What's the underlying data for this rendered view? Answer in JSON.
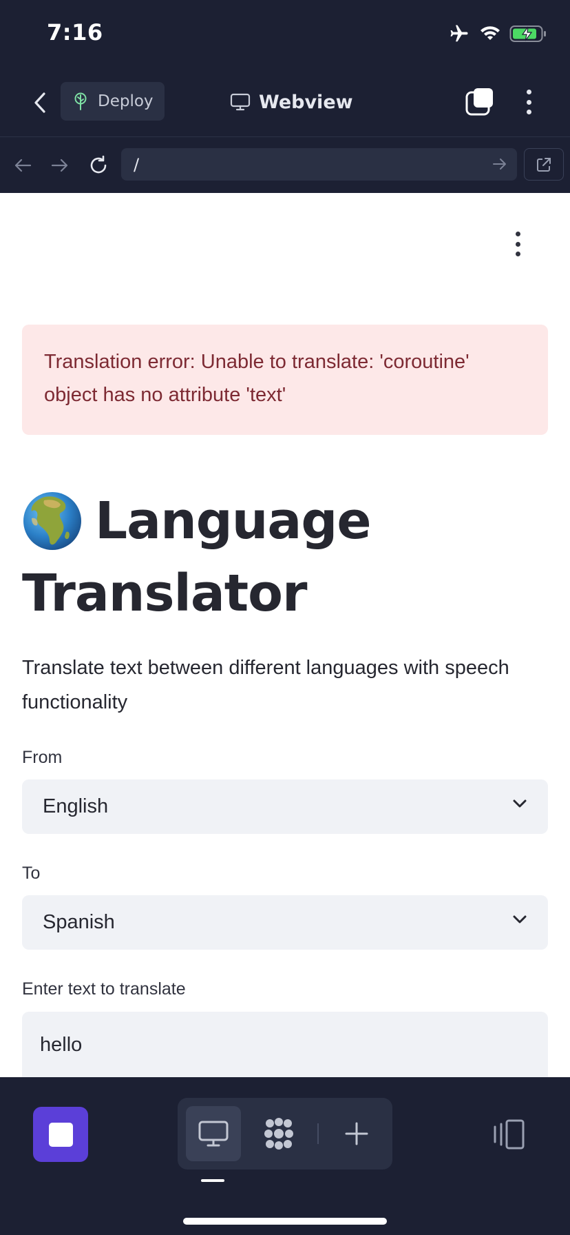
{
  "status_bar": {
    "time": "7:16",
    "icons": [
      "airplane-icon",
      "wifi-icon",
      "battery-charging-icon"
    ],
    "battery_color": "#4cd964"
  },
  "app_header": {
    "deploy_label": "Deploy",
    "webview_label": "Webview",
    "deploy_icon_color": "#7ee0a4"
  },
  "browser_bar": {
    "url": "/"
  },
  "page": {
    "error_message": "Translation error: Unable to translate: 'coroutine' object has no attribute 'text'",
    "title_emoji_name": "globe-africa-icon",
    "title_line1": "Language",
    "title_line2": "Translator",
    "subtitle": "Translate text between different languages with speech functionality",
    "from_label": "From",
    "from_value": "English",
    "to_label": "To",
    "to_value": "Spanish",
    "input_label": "Enter text to translate",
    "input_value": "hello"
  },
  "dock": {
    "accent_color": "#5b3fd8",
    "items": [
      "stop-icon",
      "desktop-icon",
      "agents-icon",
      "plus-icon",
      "panel-icon"
    ]
  }
}
